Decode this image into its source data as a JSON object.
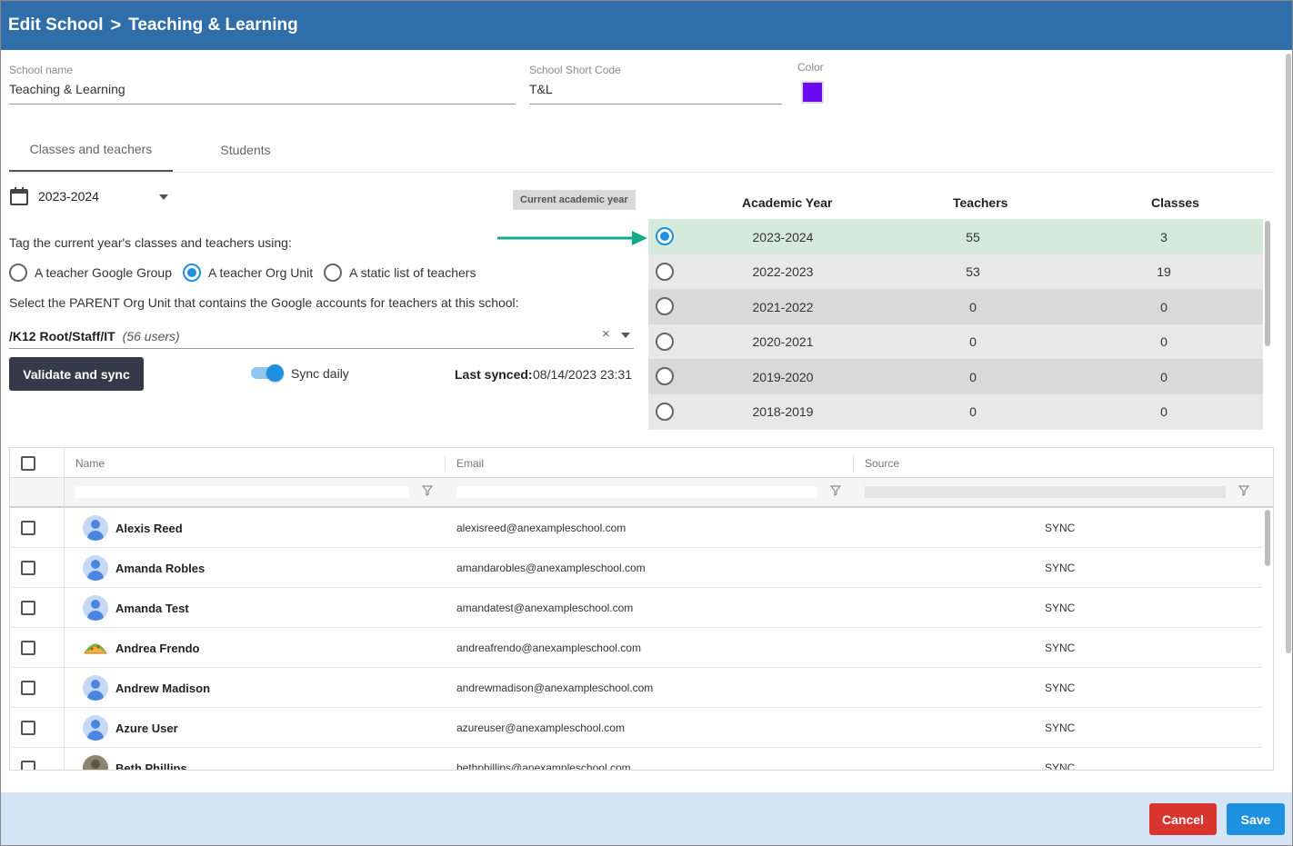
{
  "header": {
    "title": "Edit School",
    "subtitle": "Teaching & Learning",
    "separator": ">"
  },
  "form": {
    "school_name": {
      "label": "School name",
      "value": "Teaching & Learning"
    },
    "short_code": {
      "label": "School Short Code",
      "value": "T&L"
    },
    "color": {
      "label": "Color",
      "value": "#6a0af0"
    }
  },
  "tabs": [
    {
      "label": "Classes and teachers",
      "active": true
    },
    {
      "label": "Students",
      "active": false
    }
  ],
  "year_picker": {
    "icon": "calendar-icon",
    "value": "2023-2024",
    "badge": "Current academic year"
  },
  "tagging": {
    "prompt": "Tag the current year's classes and teachers using:",
    "options": [
      {
        "label": "A teacher Google Group",
        "selected": false
      },
      {
        "label": "A teacher Org Unit",
        "selected": true
      },
      {
        "label": "A static list of teachers",
        "selected": false
      }
    ],
    "org_prompt": "Select the PARENT Org Unit that contains the Google accounts for teachers at this school:",
    "org_unit": {
      "path": "/K12 Root/Staff/IT",
      "users": "(56 users)",
      "clear": "×"
    }
  },
  "sync": {
    "button": "Validate and sync",
    "toggle_label": "Sync daily",
    "toggle_on": true,
    "last_synced_label": "Last synced:",
    "last_synced_value": "08/14/2023 23:31"
  },
  "years_table": {
    "headers": {
      "year": "Academic Year",
      "teachers": "Teachers",
      "classes": "Classes"
    },
    "rows": [
      {
        "year": "2023-2024",
        "teachers": "55",
        "classes": "3",
        "selected": true,
        "bg": "#d6eadb"
      },
      {
        "year": "2022-2023",
        "teachers": "53",
        "classes": "19",
        "selected": false,
        "bg": "#e8e8e8"
      },
      {
        "year": "2021-2022",
        "teachers": "0",
        "classes": "0",
        "selected": false,
        "bg": "#d9d9d9"
      },
      {
        "year": "2020-2021",
        "teachers": "0",
        "classes": "0",
        "selected": false,
        "bg": "#e8e8e8"
      },
      {
        "year": "2019-2020",
        "teachers": "0",
        "classes": "0",
        "selected": false,
        "bg": "#d9d9d9"
      },
      {
        "year": "2018-2019",
        "teachers": "0",
        "classes": "0",
        "selected": false,
        "bg": "#e8e8e8"
      }
    ]
  },
  "grid": {
    "columns": {
      "name": "Name",
      "email": "Email",
      "source": "Source"
    },
    "rows": [
      {
        "name": "Alexis Reed",
        "email": "alexisreed@anexampleschool.com",
        "source": "SYNC",
        "avatar": "default"
      },
      {
        "name": "Amanda Robles",
        "email": "amandarobles@anexampleschool.com",
        "source": "SYNC",
        "avatar": "default"
      },
      {
        "name": "Amanda Test",
        "email": "amandatest@anexampleschool.com",
        "source": "SYNC",
        "avatar": "default"
      },
      {
        "name": "Andrea Frendo",
        "email": "andreafrendo@anexampleschool.com",
        "source": "SYNC",
        "avatar": "taco"
      },
      {
        "name": "Andrew Madison",
        "email": "andrewmadison@anexampleschool.com",
        "source": "SYNC",
        "avatar": "default"
      },
      {
        "name": "Azure User",
        "email": "azureuser@anexampleschool.com",
        "source": "SYNC",
        "avatar": "default"
      },
      {
        "name": "Beth Phillips",
        "email": "bethphillips@anexampleschool.com",
        "source": "SYNC",
        "avatar": "photo"
      }
    ]
  },
  "footer": {
    "cancel": "Cancel",
    "save": "Save"
  },
  "colors": {
    "header": "#2f6ea8",
    "accent": "#1e90e0",
    "cancel": "#d9352e",
    "footer": "#d5e5f5",
    "arrow": "#15a88a"
  }
}
